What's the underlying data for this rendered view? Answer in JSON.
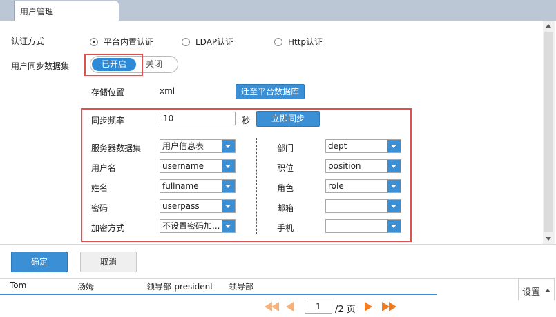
{
  "tab": {
    "label": "用户管理"
  },
  "auth": {
    "label": "认证方式",
    "options": [
      {
        "label": "平台内置认证",
        "selected": true
      },
      {
        "label": "LDAP认证",
        "selected": false
      },
      {
        "label": "Http认证",
        "selected": false
      }
    ]
  },
  "sync_dataset": {
    "label": "用户同步数据集",
    "on_label": "已开启",
    "off_label": "关闭",
    "enabled": true
  },
  "storage": {
    "label": "存储位置",
    "value": "xml",
    "migrate_button": "迁至平台数据库"
  },
  "sync": {
    "frequency_label": "同步频率",
    "frequency_value": "10",
    "unit": "秒",
    "sync_now_button": "立即同步"
  },
  "mapping": {
    "left": [
      {
        "label": "服务器数据集",
        "value": "用户信息表"
      },
      {
        "label": "用户名",
        "value": "username"
      },
      {
        "label": "姓名",
        "value": "fullname"
      },
      {
        "label": "密码",
        "value": "userpass"
      },
      {
        "label": "加密方式",
        "value": "不设置密码加..."
      }
    ],
    "right": [
      {
        "label": "部门",
        "value": "dept"
      },
      {
        "label": "职位",
        "value": "position"
      },
      {
        "label": "角色",
        "value": "role"
      },
      {
        "label": "邮箱",
        "value": ""
      },
      {
        "label": "手机",
        "value": ""
      }
    ]
  },
  "footer": {
    "confirm": "确定",
    "cancel": "取消"
  },
  "table_row": {
    "cells": [
      "Tom",
      "汤姆",
      "领导部-president",
      "领导部"
    ]
  },
  "settings": {
    "label": "设置"
  },
  "pager": {
    "current_page": "1",
    "total_label": "/2 页"
  },
  "colors": {
    "accent": "#3b8fd5",
    "highlight": "#e05050",
    "pager": "#f07c22"
  }
}
